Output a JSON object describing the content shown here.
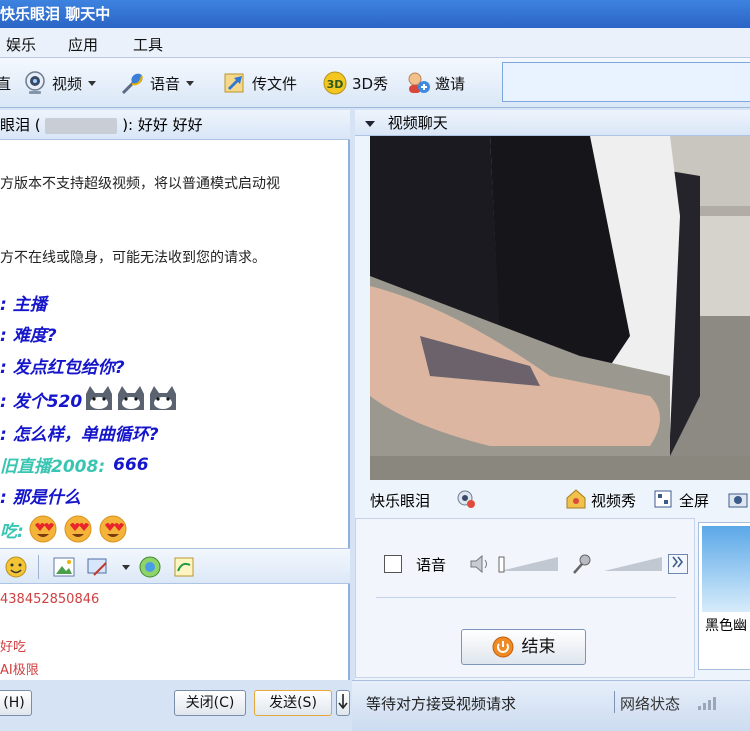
{
  "window": {
    "title": "快乐眼泪  聊天中"
  },
  "menu": {
    "items": [
      "娱乐",
      "应用",
      "工具"
    ]
  },
  "toolbar": {
    "first_label": "直",
    "video_label": "视频",
    "voice_label": "语音",
    "file_label": "传文件",
    "show3d_label": "3D秀",
    "invite_label": "邀请"
  },
  "chat": {
    "header_name": "眼泪 (",
    "header_status": "): 好好   好好",
    "system_messages": [
      "方版本不支持超级视频，将以普通模式启动视",
      "方不在线或隐身，可能无法收到您的请求。"
    ],
    "messages": [
      {
        "text": ": 主播",
        "style": "blue",
        "emojis": 0
      },
      {
        "text": ": 难度?",
        "style": "blue",
        "emojis": 0
      },
      {
        "text": ": 发点红包给你?",
        "style": "blue",
        "emojis": 0
      },
      {
        "text": ": 发个520",
        "style": "blue",
        "emojis": 3
      },
      {
        "text": ": 怎么样，单曲循环?",
        "style": "blue",
        "emojis": 0
      },
      {
        "text": "旧直播2008:",
        "style": "teal",
        "extra": "666",
        "emojis": 0
      },
      {
        "text": ": 那是什么",
        "style": "blue",
        "emojis": 0
      },
      {
        "text": "吃:",
        "style": "teal",
        "emojis": 3
      }
    ],
    "input_lines": [
      "438452850846",
      "好吃",
      "AI极限"
    ]
  },
  "buttons": {
    "history_label": "(H)",
    "close_label": "关闭(C)",
    "send_label": "发送(S)"
  },
  "video_panel": {
    "title": "视频聊天",
    "contact_name": "快乐眼泪",
    "video_show_label": "视频秀",
    "fullscreen_label": "全屏",
    "voice_label": "语音",
    "end_label": "结束",
    "thumb_label": "黑色幽"
  },
  "status": {
    "waiting_text": "等待对方接受视频请求",
    "network_label": "网络状态"
  },
  "colors": {
    "title_bar": "#2a64c5",
    "message_blue": "#1515cc",
    "message_teal": "#38c6b2",
    "input_red": "#d04040"
  }
}
